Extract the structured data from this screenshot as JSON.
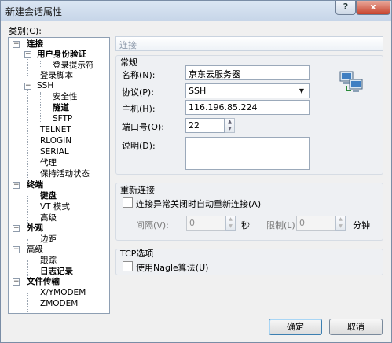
{
  "window": {
    "title": "新建会话属性",
    "help_label": "?",
    "close_label": "x"
  },
  "category_label": "类别(C):",
  "tree": {
    "connection": "连接",
    "user_auth": "用户身份验证",
    "login_prompt": "登录提示符",
    "login_script": "登录脚本",
    "ssh": "SSH",
    "security": "安全性",
    "tunnel": "隧道",
    "sftp": "SFTP",
    "telnet": "TELNET",
    "rlogin": "RLOGIN",
    "serial": "SERIAL",
    "proxy": "代理",
    "keepalive": "保持活动状态",
    "terminal": "终端",
    "keyboard": "键盘",
    "vt_mode": "VT 模式",
    "advanced": "高级",
    "appearance": "外观",
    "margin": "边距",
    "advanced2": "高级",
    "trace": "跟踪",
    "logging": "日志记录",
    "file_transfer": "文件传输",
    "xymodem": "X/YMODEM",
    "zmodem": "ZMODEM"
  },
  "panel": {
    "header": "连接",
    "general": {
      "title": "常规",
      "name_label": "名称(N):",
      "name_value": "京东云服务器",
      "protocol_label": "协议(P):",
      "protocol_value": "SSH",
      "host_label": "主机(H):",
      "host_value": "116.196.85.224",
      "port_label": "端口号(O):",
      "port_value": "22",
      "desc_label": "说明(D):",
      "desc_value": ""
    },
    "reconnect": {
      "title": "重新连接",
      "auto_label": "连接异常关闭时自动重新连接(A)",
      "interval_label": "间隔(V):",
      "interval_value": "0",
      "interval_unit": "秒",
      "limit_label": "限制(L):",
      "limit_value": "0",
      "limit_unit": "分钟"
    },
    "tcp": {
      "title": "TCP选项",
      "nagle_label": "使用Nagle算法(U)"
    }
  },
  "buttons": {
    "ok": "确定",
    "cancel": "取消"
  }
}
